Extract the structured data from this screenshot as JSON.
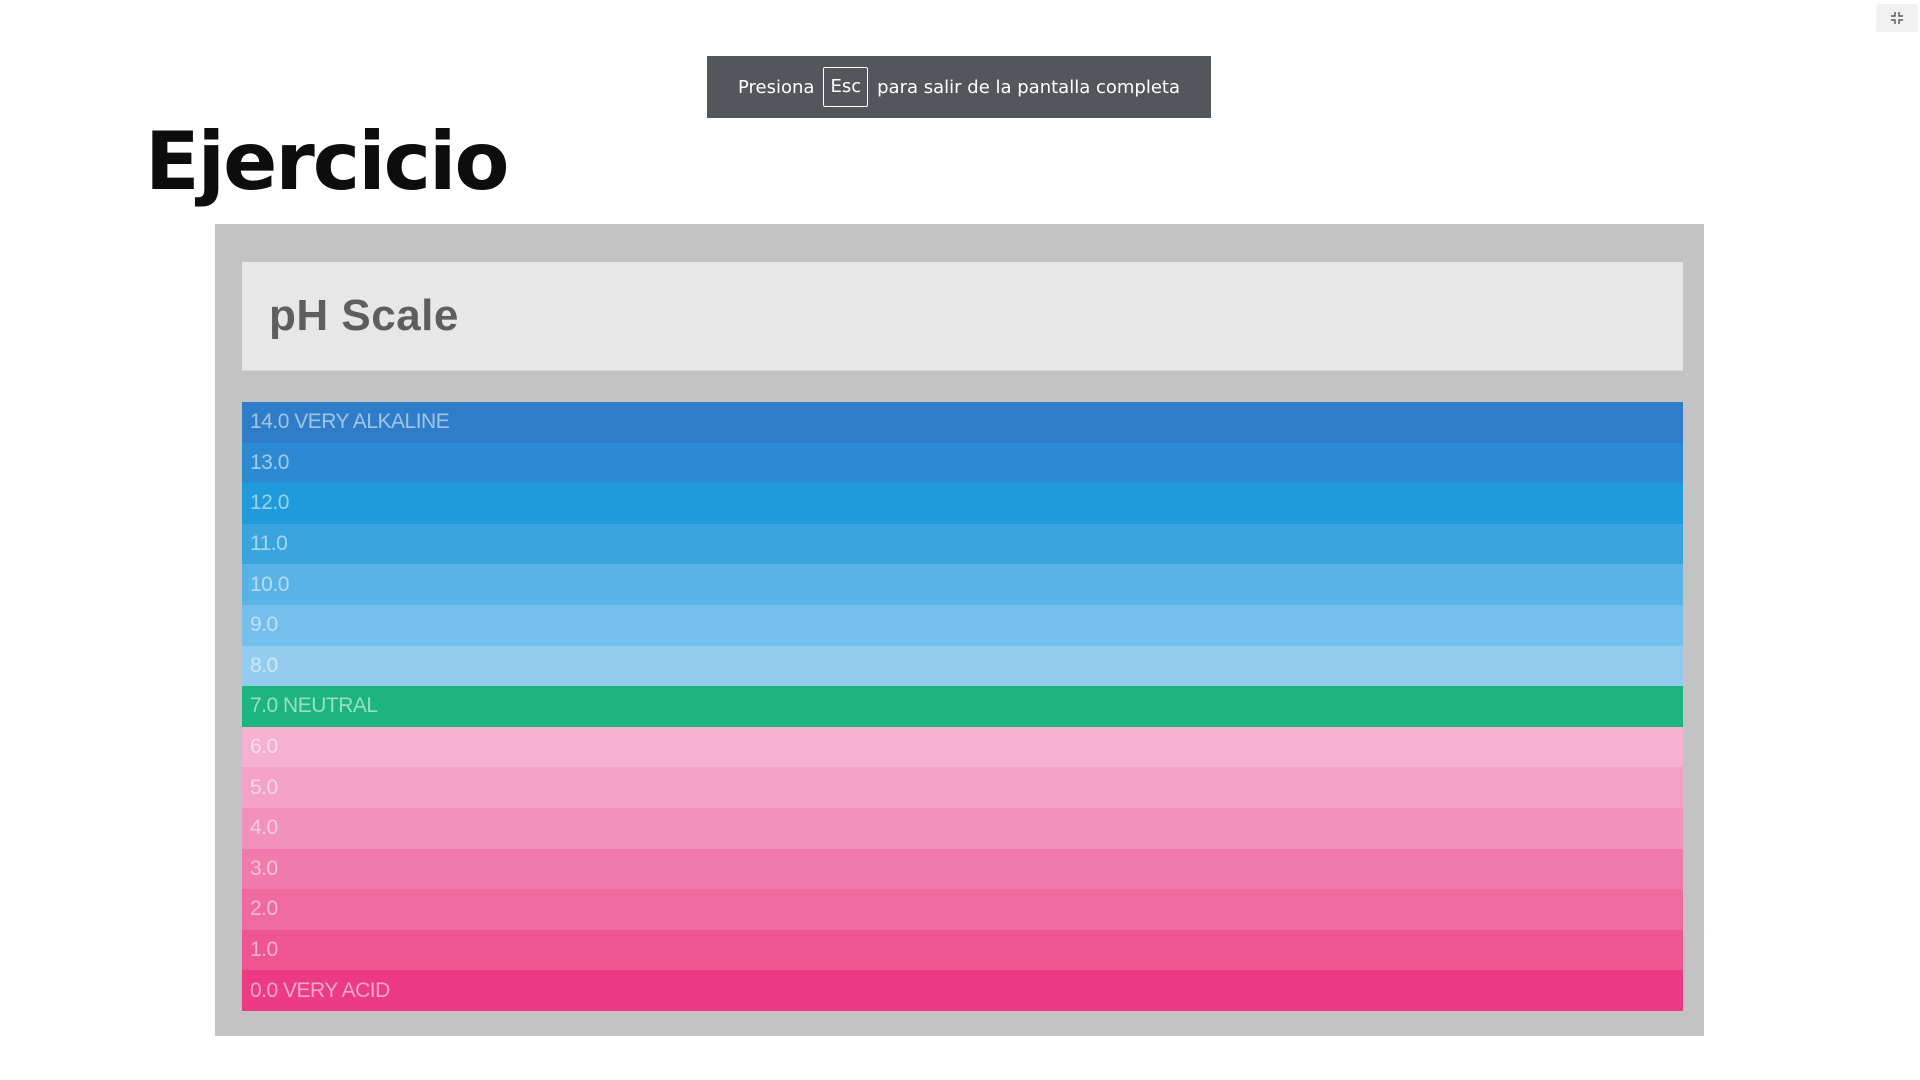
{
  "toast": {
    "before": "Presiona",
    "key": "Esc",
    "after": "para salir de la pantalla completa"
  },
  "exit_fullscreen_icon": "exit-fullscreen-icon",
  "slide": {
    "title": "Ejercicio"
  },
  "ph_image": {
    "heading": "pH Scale",
    "bands": [
      {
        "label": "14.0 VERY ALKALINE",
        "color": "#2f7dc8"
      },
      {
        "label": "13.0",
        "color": "#2b8ad2"
      },
      {
        "label": "12.0",
        "color": "#1f9adb"
      },
      {
        "label": "11.0",
        "color": "#3aa4df"
      },
      {
        "label": "10.0",
        "color": "#5ab3e6"
      },
      {
        "label": "9.0",
        "color": "#74bfeb"
      },
      {
        "label": "8.0",
        "color": "#93ccef"
      },
      {
        "label": "7.0 NEUTRAL",
        "color": "#1db57f"
      },
      {
        "label": "6.0",
        "color": "#f5b1cf"
      },
      {
        "label": "5.0",
        "color": "#f4a2c5"
      },
      {
        "label": "4.0",
        "color": "#f291ba"
      },
      {
        "label": "3.0",
        "color": "#f07aab"
      },
      {
        "label": "2.0",
        "color": "#ef6a9f"
      },
      {
        "label": "1.0",
        "color": "#ee5591"
      },
      {
        "label": "0.0 VERY ACID",
        "color": "#ec3a84"
      }
    ]
  }
}
